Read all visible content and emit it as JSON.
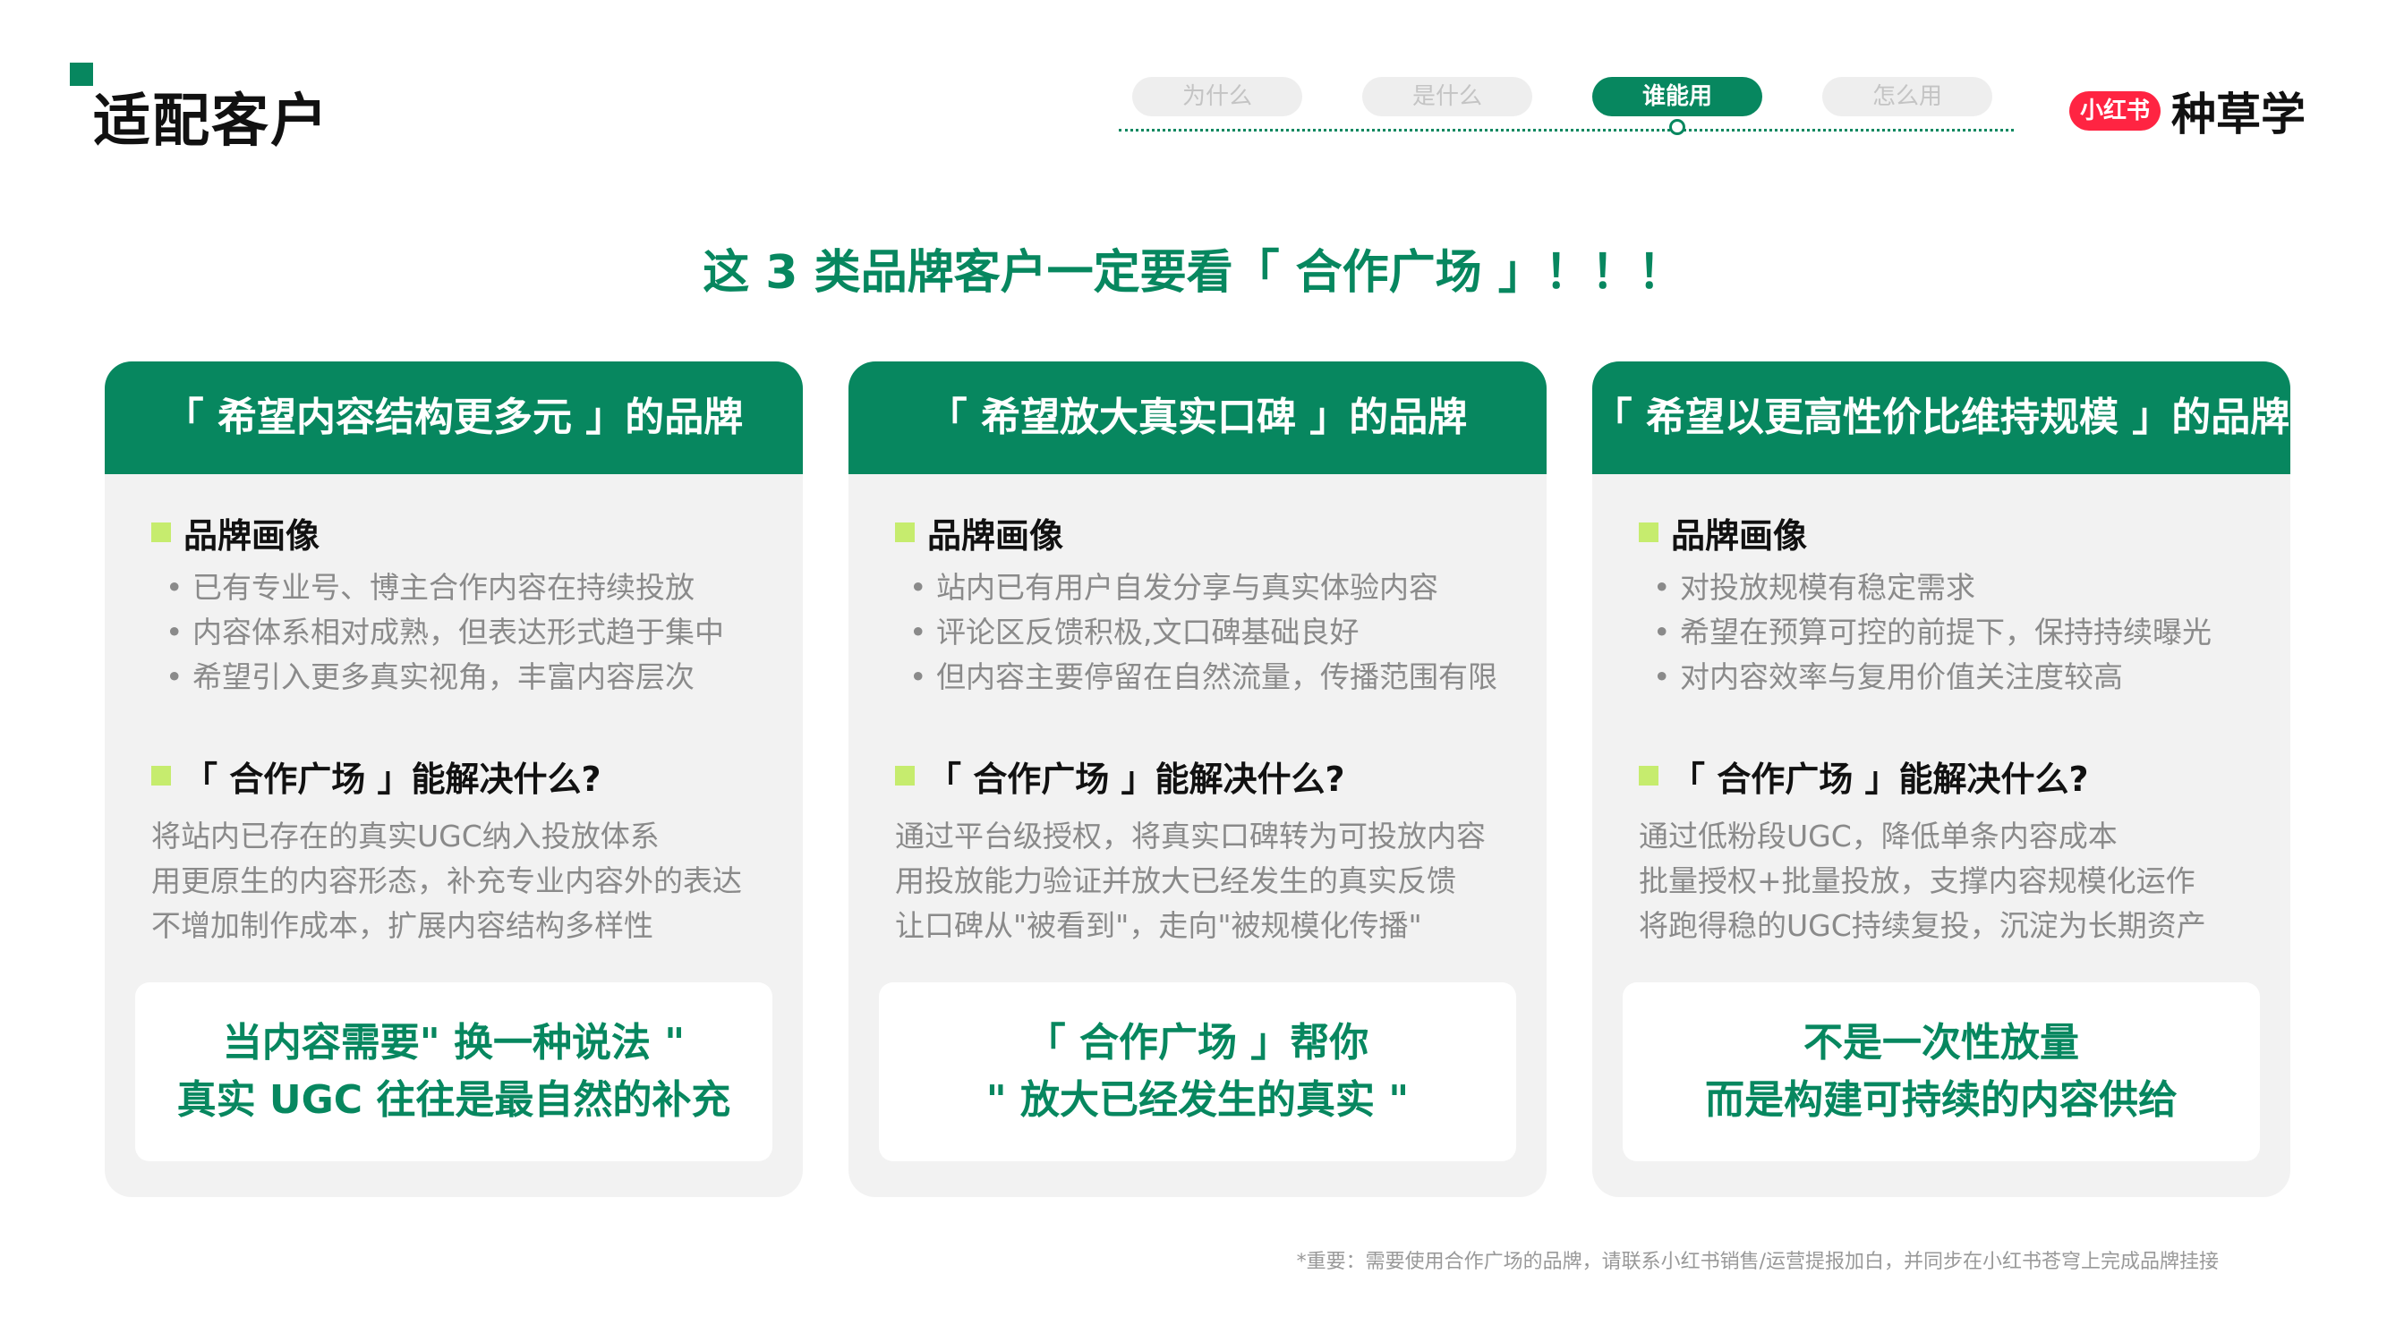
{
  "page": {
    "title": "适配客户"
  },
  "nav": {
    "items": [
      {
        "label": "为什么"
      },
      {
        "label": "是什么"
      },
      {
        "label": "谁能用"
      },
      {
        "label": "怎么用"
      }
    ],
    "active_index": 2
  },
  "brand": {
    "logo_text": "小红书",
    "name": "种草学",
    "color": "#ff2442"
  },
  "headline": "这 3 类品牌客户一定要看「 合作广场 」！！！",
  "colors": {
    "accent": "#07875f",
    "bullet_mark": "#c6ec6e",
    "card_bg": "#f2f2f2",
    "muted_text": "#8a8a8a"
  },
  "cards": [
    {
      "header": "「 希望内容结构更多元 」的品牌",
      "portrait_title": "品牌画像",
      "portrait_items": [
        "已有专业号、博主合作内容在持续投放",
        "内容体系相对成熟，但表达形式趋于集中",
        "希望引入更多真实视角，丰富内容层次"
      ],
      "solve_title": "「 合作广场 」能解决什么?",
      "solve_lines": [
        "将站内已存在的真实UGC纳入投放体系",
        "用更原生的内容形态，补充专业内容外的表达",
        "不增加制作成本，扩展内容结构多样性"
      ],
      "highlight": [
        "当内容需要\" 换一种说法 \"",
        "真实 UGC 往往是最自然的补充"
      ]
    },
    {
      "header": "「 希望放大真实口碑 」的品牌",
      "portrait_title": "品牌画像",
      "portrait_items": [
        "站内已有用户自发分享与真实体验内容",
        "评论区反馈积极,文口碑基础良好",
        "但内容主要停留在自然流量，传播范围有限"
      ],
      "solve_title": "「 合作广场 」能解决什么?",
      "solve_lines": [
        "通过平台级授权，将真实口碑转为可投放内容",
        "用投放能力验证并放大已经发生的真实反馈",
        "让口碑从\"被看到\"，走向\"被规模化传播\""
      ],
      "highlight": [
        "「 合作广场 」帮你",
        "\" 放大已经发生的真实 \""
      ]
    },
    {
      "header": "「 希望以更高性价比维持规模 」的品牌",
      "portrait_title": "品牌画像",
      "portrait_items": [
        "对投放规模有稳定需求",
        "希望在预算可控的前提下，保持持续曝光",
        "对内容效率与复用价值关注度较高"
      ],
      "solve_title": "「 合作广场 」能解决什么?",
      "solve_lines": [
        "通过低粉段UGC，降低单条内容成本",
        "批量授权+批量投放，支撑内容规模化运作",
        "将跑得稳的UGC持续复投，沉淀为长期资产"
      ],
      "highlight": [
        "不是一次性放量",
        "而是构建可持续的内容供给"
      ]
    }
  ],
  "footnote": "*重要：需要使用合作广场的品牌，请联系小红书销售/运营提报加白，并同步在小红书苍穹上完成品牌挂接"
}
